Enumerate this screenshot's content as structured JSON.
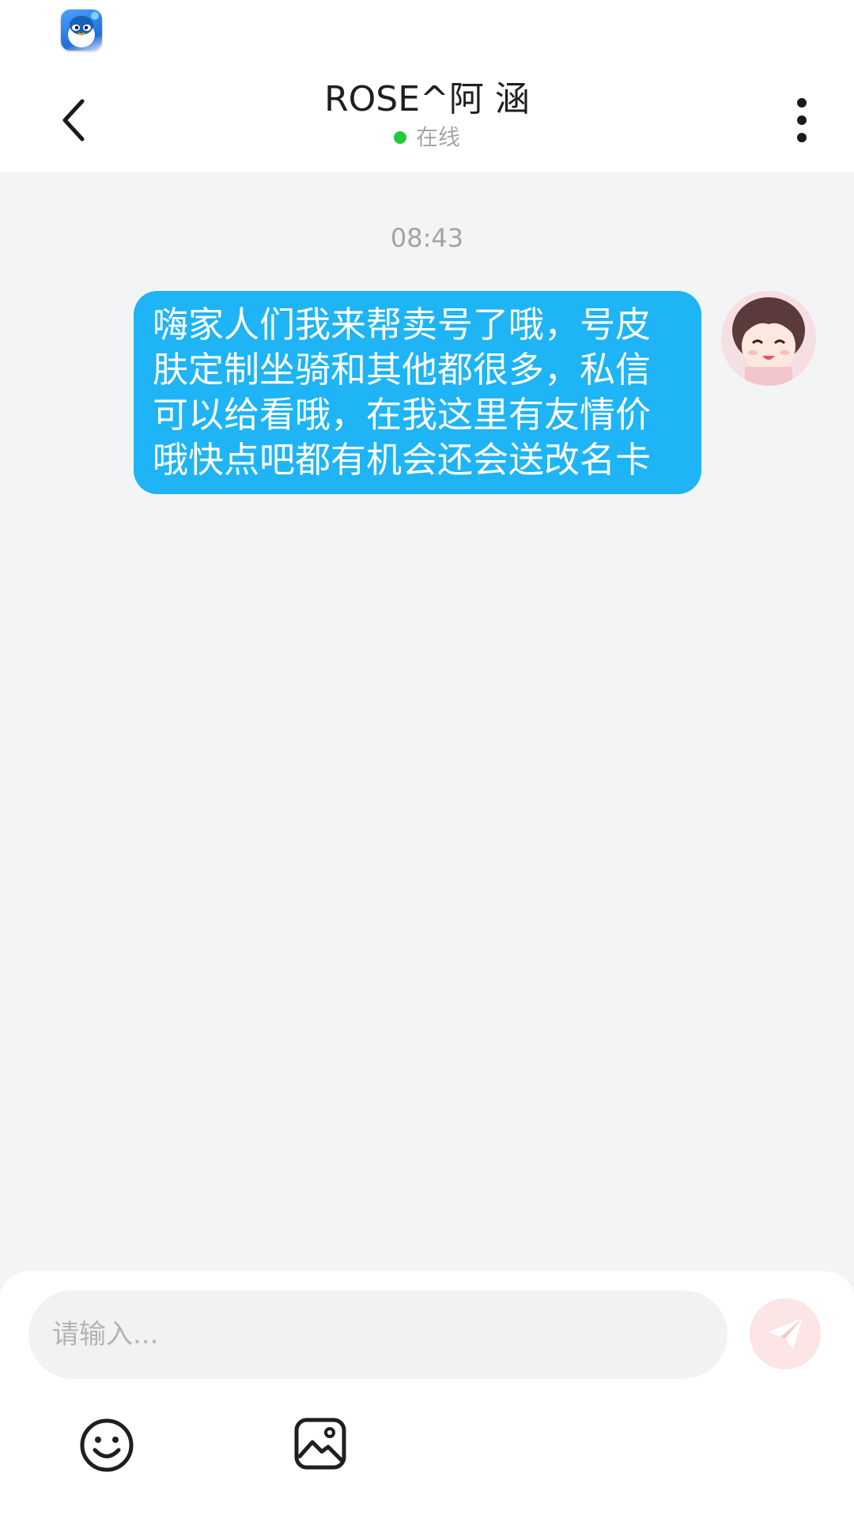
{
  "status_bar": {
    "app_icon": "qq-penguin-icon"
  },
  "header": {
    "back_icon": "chevron-left-icon",
    "title": "ROSE^阿 涵",
    "presence_text": "在线",
    "presence_color": "#21c93c",
    "more_icon": "more-vertical-icon"
  },
  "conversation": {
    "timestamp": "08:43",
    "messages": [
      {
        "sender": "self",
        "text": "嗨家人们我来帮卖号了哦，号皮肤定制坐骑和其他都很多，私信可以给看哦，在我这里有友情价哦快点吧都有机会还会送改名卡",
        "bubble_color": "#1eb4f5",
        "avatar": "anime-girl-avatar"
      }
    ]
  },
  "composer": {
    "placeholder": "请输入...",
    "value": "",
    "send_icon": "paper-plane-icon",
    "send_color": "#fde5e5",
    "emoji_icon": "smiley-icon",
    "image_icon": "image-icon"
  }
}
